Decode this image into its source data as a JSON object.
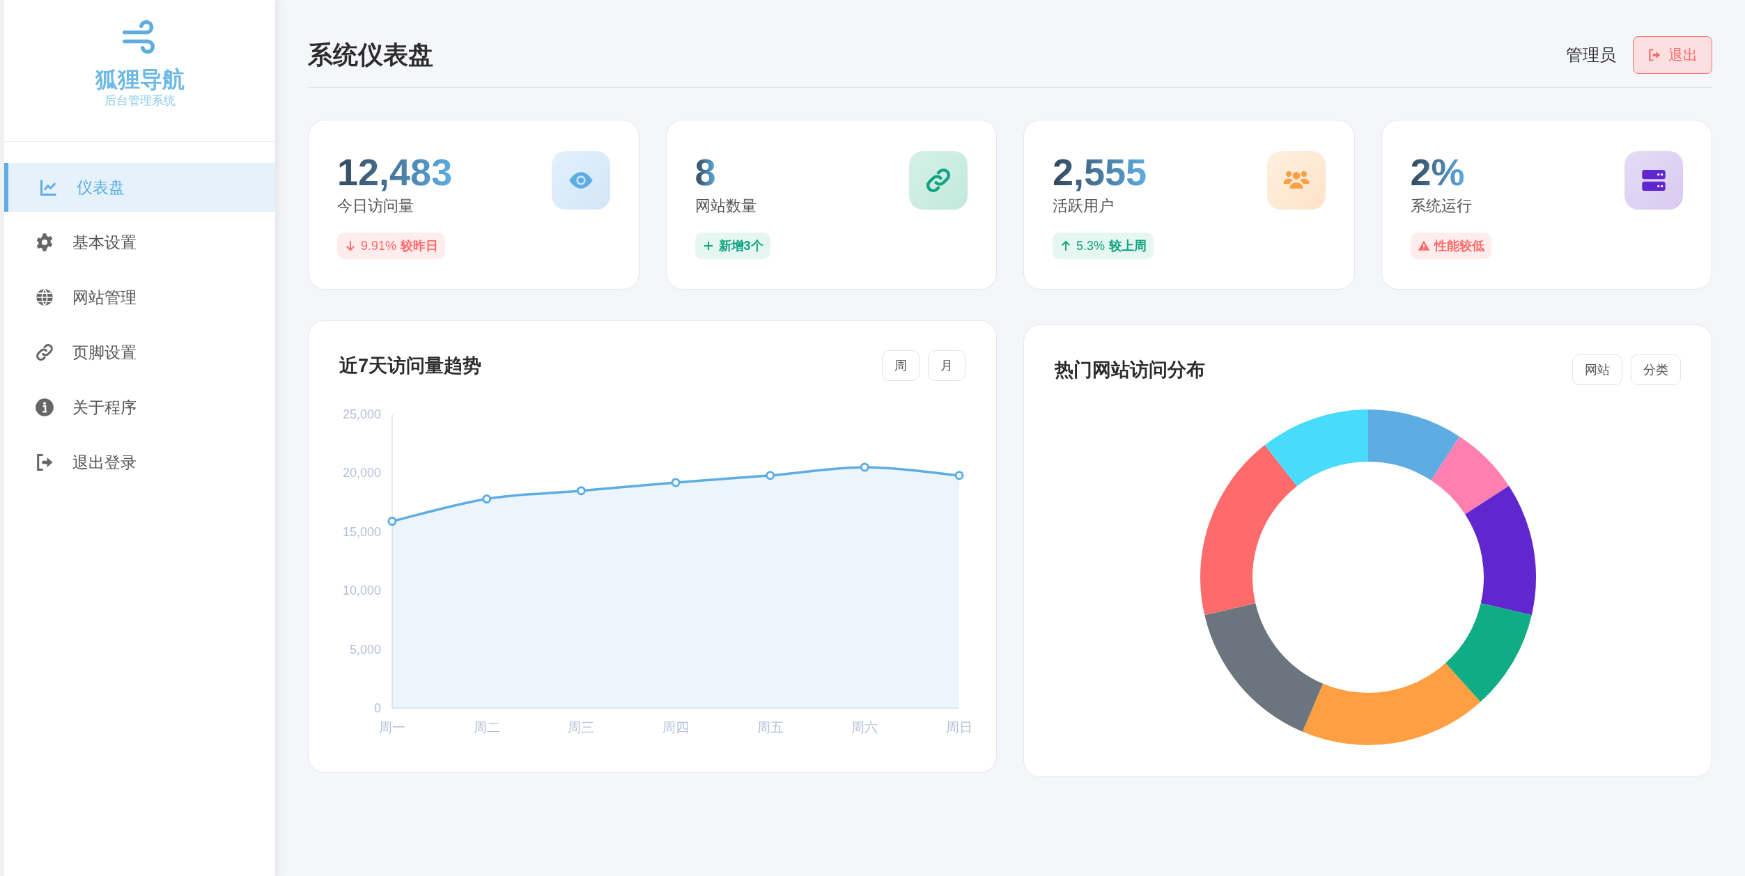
{
  "sidebar": {
    "brand": "狐狸导航",
    "subtitle": "后台管理系统",
    "items": [
      {
        "kind": "chart",
        "label": "仪表盘",
        "selected": true
      },
      {
        "kind": "gear",
        "label": "基本设置",
        "selected": false
      },
      {
        "kind": "globe",
        "label": "网站管理",
        "selected": false
      },
      {
        "kind": "link",
        "label": "页脚设置",
        "selected": false
      },
      {
        "kind": "info",
        "label": "关于程序",
        "selected": false
      },
      {
        "kind": "logout",
        "label": "退出登录",
        "selected": false
      }
    ]
  },
  "header": {
    "title": "系统仪表盘",
    "user": "管理员",
    "logout": "退出"
  },
  "stats": [
    {
      "value": "12,483",
      "label": "今日访问量",
      "kind": "eye",
      "badge": {
        "kind": "down",
        "text": "9.91%",
        "suffix": "较昨日"
      }
    },
    {
      "value": "8",
      "label": "网站数量",
      "kind": "link",
      "badge": {
        "kind": "plus",
        "suffix": "新增3个"
      }
    },
    {
      "value": "2,555",
      "label": "活跃用户",
      "kind": "users",
      "badge": {
        "kind": "up",
        "text": "5.3%",
        "suffix": "较上周"
      }
    },
    {
      "value": "2%",
      "label": "系统运行",
      "kind": "server",
      "badge": {
        "kind": "warning",
        "suffix": "性能较低"
      }
    }
  ],
  "trend": {
    "title": "近7天访问量趋势",
    "buttons": [
      "周",
      "月"
    ],
    "chart_data": {
      "type": "area",
      "categories": [
        "周一",
        "周二",
        "周三",
        "周四",
        "周五",
        "周六",
        "周日"
      ],
      "series": [
        {
          "color": "#5dade2",
          "values": [
            15900,
            17800,
            18500,
            19200,
            19800,
            20500,
            19800
          ]
        }
      ],
      "ylim": [
        0,
        25000
      ],
      "yticks": [
        {
          "value": 0,
          "label": "0"
        },
        {
          "value": 5000,
          "label": "5,000"
        },
        {
          "value": 10000,
          "label": "10,000"
        },
        {
          "value": 15000,
          "label": "15,000"
        },
        {
          "value": 20000,
          "label": "20,000"
        },
        {
          "value": 25000,
          "label": "25,000"
        }
      ]
    }
  },
  "distribution": {
    "title": "热门网站访问分布",
    "buttons": [
      "网站",
      "分类"
    ]
  }
}
